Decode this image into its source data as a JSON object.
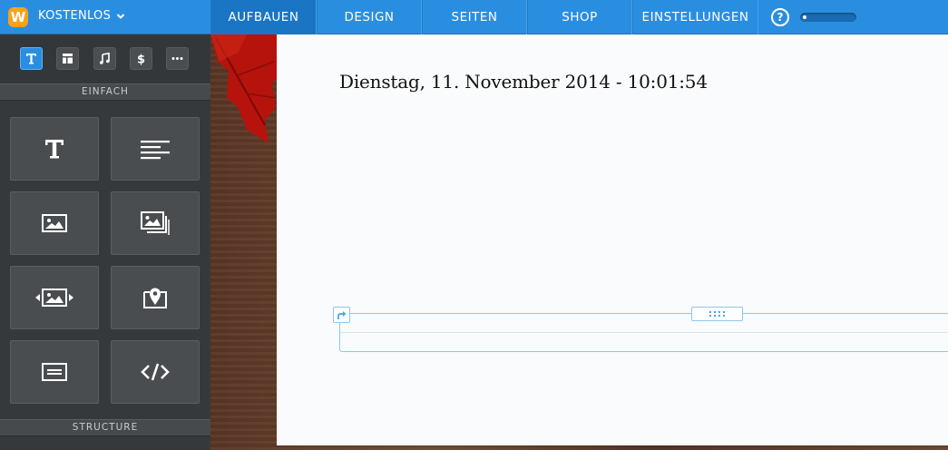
{
  "topbar": {
    "logo_letter": "W",
    "plan_label": "KOSTENLOS",
    "tabs": [
      {
        "label": "AUFBAUEN",
        "active": true
      },
      {
        "label": "DESIGN",
        "active": false
      },
      {
        "label": "SEITEN",
        "active": false
      },
      {
        "label": "SHOP",
        "active": false
      },
      {
        "label": "EINSTELLUNGEN",
        "active": false
      }
    ],
    "help_label": "?",
    "progress_fraction": 0.05
  },
  "sidebar": {
    "tools": [
      {
        "icon": "text-tool-icon",
        "active": true
      },
      {
        "icon": "layout-tool-icon",
        "active": false
      },
      {
        "icon": "music-tool-icon",
        "active": false
      },
      {
        "icon": "dollar-tool-icon",
        "active": false
      },
      {
        "icon": "more-tool-icon",
        "active": false
      }
    ],
    "section_basic": "EINFACH",
    "section_structure": "STRUCTURE",
    "tiles": [
      {
        "icon": "title-icon"
      },
      {
        "icon": "text-icon"
      },
      {
        "icon": "image-icon"
      },
      {
        "icon": "gallery-icon"
      },
      {
        "icon": "slideshow-icon"
      },
      {
        "icon": "map-icon"
      },
      {
        "icon": "contact-form-icon"
      },
      {
        "icon": "embed-code-icon"
      }
    ]
  },
  "page": {
    "date_text": "Dienstag, 11. November 2014 - 10:01:54"
  },
  "colors": {
    "brand_blue": "#2a8ee0",
    "logo_orange": "#f7a21b",
    "sidebar_bg": "#36393b",
    "edit_border": "#8ec6ee"
  }
}
